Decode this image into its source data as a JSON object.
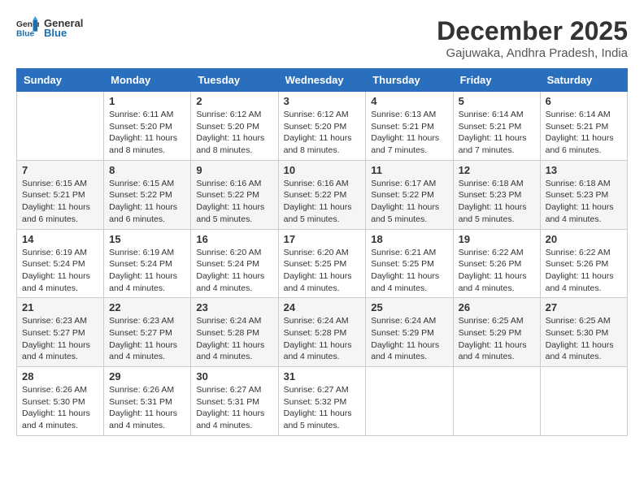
{
  "header": {
    "logo_general": "General",
    "logo_blue": "Blue",
    "month_title": "December 2025",
    "location": "Gajuwaka, Andhra Pradesh, India"
  },
  "days_of_week": [
    "Sunday",
    "Monday",
    "Tuesday",
    "Wednesday",
    "Thursday",
    "Friday",
    "Saturday"
  ],
  "weeks": [
    [
      {
        "day": "",
        "info": ""
      },
      {
        "day": "1",
        "info": "Sunrise: 6:11 AM\nSunset: 5:20 PM\nDaylight: 11 hours\nand 8 minutes."
      },
      {
        "day": "2",
        "info": "Sunrise: 6:12 AM\nSunset: 5:20 PM\nDaylight: 11 hours\nand 8 minutes."
      },
      {
        "day": "3",
        "info": "Sunrise: 6:12 AM\nSunset: 5:20 PM\nDaylight: 11 hours\nand 8 minutes."
      },
      {
        "day": "4",
        "info": "Sunrise: 6:13 AM\nSunset: 5:21 PM\nDaylight: 11 hours\nand 7 minutes."
      },
      {
        "day": "5",
        "info": "Sunrise: 6:14 AM\nSunset: 5:21 PM\nDaylight: 11 hours\nand 7 minutes."
      },
      {
        "day": "6",
        "info": "Sunrise: 6:14 AM\nSunset: 5:21 PM\nDaylight: 11 hours\nand 6 minutes."
      }
    ],
    [
      {
        "day": "7",
        "info": "Sunrise: 6:15 AM\nSunset: 5:21 PM\nDaylight: 11 hours\nand 6 minutes."
      },
      {
        "day": "8",
        "info": "Sunrise: 6:15 AM\nSunset: 5:22 PM\nDaylight: 11 hours\nand 6 minutes."
      },
      {
        "day": "9",
        "info": "Sunrise: 6:16 AM\nSunset: 5:22 PM\nDaylight: 11 hours\nand 5 minutes."
      },
      {
        "day": "10",
        "info": "Sunrise: 6:16 AM\nSunset: 5:22 PM\nDaylight: 11 hours\nand 5 minutes."
      },
      {
        "day": "11",
        "info": "Sunrise: 6:17 AM\nSunset: 5:22 PM\nDaylight: 11 hours\nand 5 minutes."
      },
      {
        "day": "12",
        "info": "Sunrise: 6:18 AM\nSunset: 5:23 PM\nDaylight: 11 hours\nand 5 minutes."
      },
      {
        "day": "13",
        "info": "Sunrise: 6:18 AM\nSunset: 5:23 PM\nDaylight: 11 hours\nand 4 minutes."
      }
    ],
    [
      {
        "day": "14",
        "info": "Sunrise: 6:19 AM\nSunset: 5:24 PM\nDaylight: 11 hours\nand 4 minutes."
      },
      {
        "day": "15",
        "info": "Sunrise: 6:19 AM\nSunset: 5:24 PM\nDaylight: 11 hours\nand 4 minutes."
      },
      {
        "day": "16",
        "info": "Sunrise: 6:20 AM\nSunset: 5:24 PM\nDaylight: 11 hours\nand 4 minutes."
      },
      {
        "day": "17",
        "info": "Sunrise: 6:20 AM\nSunset: 5:25 PM\nDaylight: 11 hours\nand 4 minutes."
      },
      {
        "day": "18",
        "info": "Sunrise: 6:21 AM\nSunset: 5:25 PM\nDaylight: 11 hours\nand 4 minutes."
      },
      {
        "day": "19",
        "info": "Sunrise: 6:22 AM\nSunset: 5:26 PM\nDaylight: 11 hours\nand 4 minutes."
      },
      {
        "day": "20",
        "info": "Sunrise: 6:22 AM\nSunset: 5:26 PM\nDaylight: 11 hours\nand 4 minutes."
      }
    ],
    [
      {
        "day": "21",
        "info": "Sunrise: 6:23 AM\nSunset: 5:27 PM\nDaylight: 11 hours\nand 4 minutes."
      },
      {
        "day": "22",
        "info": "Sunrise: 6:23 AM\nSunset: 5:27 PM\nDaylight: 11 hours\nand 4 minutes."
      },
      {
        "day": "23",
        "info": "Sunrise: 6:24 AM\nSunset: 5:28 PM\nDaylight: 11 hours\nand 4 minutes."
      },
      {
        "day": "24",
        "info": "Sunrise: 6:24 AM\nSunset: 5:28 PM\nDaylight: 11 hours\nand 4 minutes."
      },
      {
        "day": "25",
        "info": "Sunrise: 6:24 AM\nSunset: 5:29 PM\nDaylight: 11 hours\nand 4 minutes."
      },
      {
        "day": "26",
        "info": "Sunrise: 6:25 AM\nSunset: 5:29 PM\nDaylight: 11 hours\nand 4 minutes."
      },
      {
        "day": "27",
        "info": "Sunrise: 6:25 AM\nSunset: 5:30 PM\nDaylight: 11 hours\nand 4 minutes."
      }
    ],
    [
      {
        "day": "28",
        "info": "Sunrise: 6:26 AM\nSunset: 5:30 PM\nDaylight: 11 hours\nand 4 minutes."
      },
      {
        "day": "29",
        "info": "Sunrise: 6:26 AM\nSunset: 5:31 PM\nDaylight: 11 hours\nand 4 minutes."
      },
      {
        "day": "30",
        "info": "Sunrise: 6:27 AM\nSunset: 5:31 PM\nDaylight: 11 hours\nand 4 minutes."
      },
      {
        "day": "31",
        "info": "Sunrise: 6:27 AM\nSunset: 5:32 PM\nDaylight: 11 hours\nand 5 minutes."
      },
      {
        "day": "",
        "info": ""
      },
      {
        "day": "",
        "info": ""
      },
      {
        "day": "",
        "info": ""
      }
    ]
  ]
}
